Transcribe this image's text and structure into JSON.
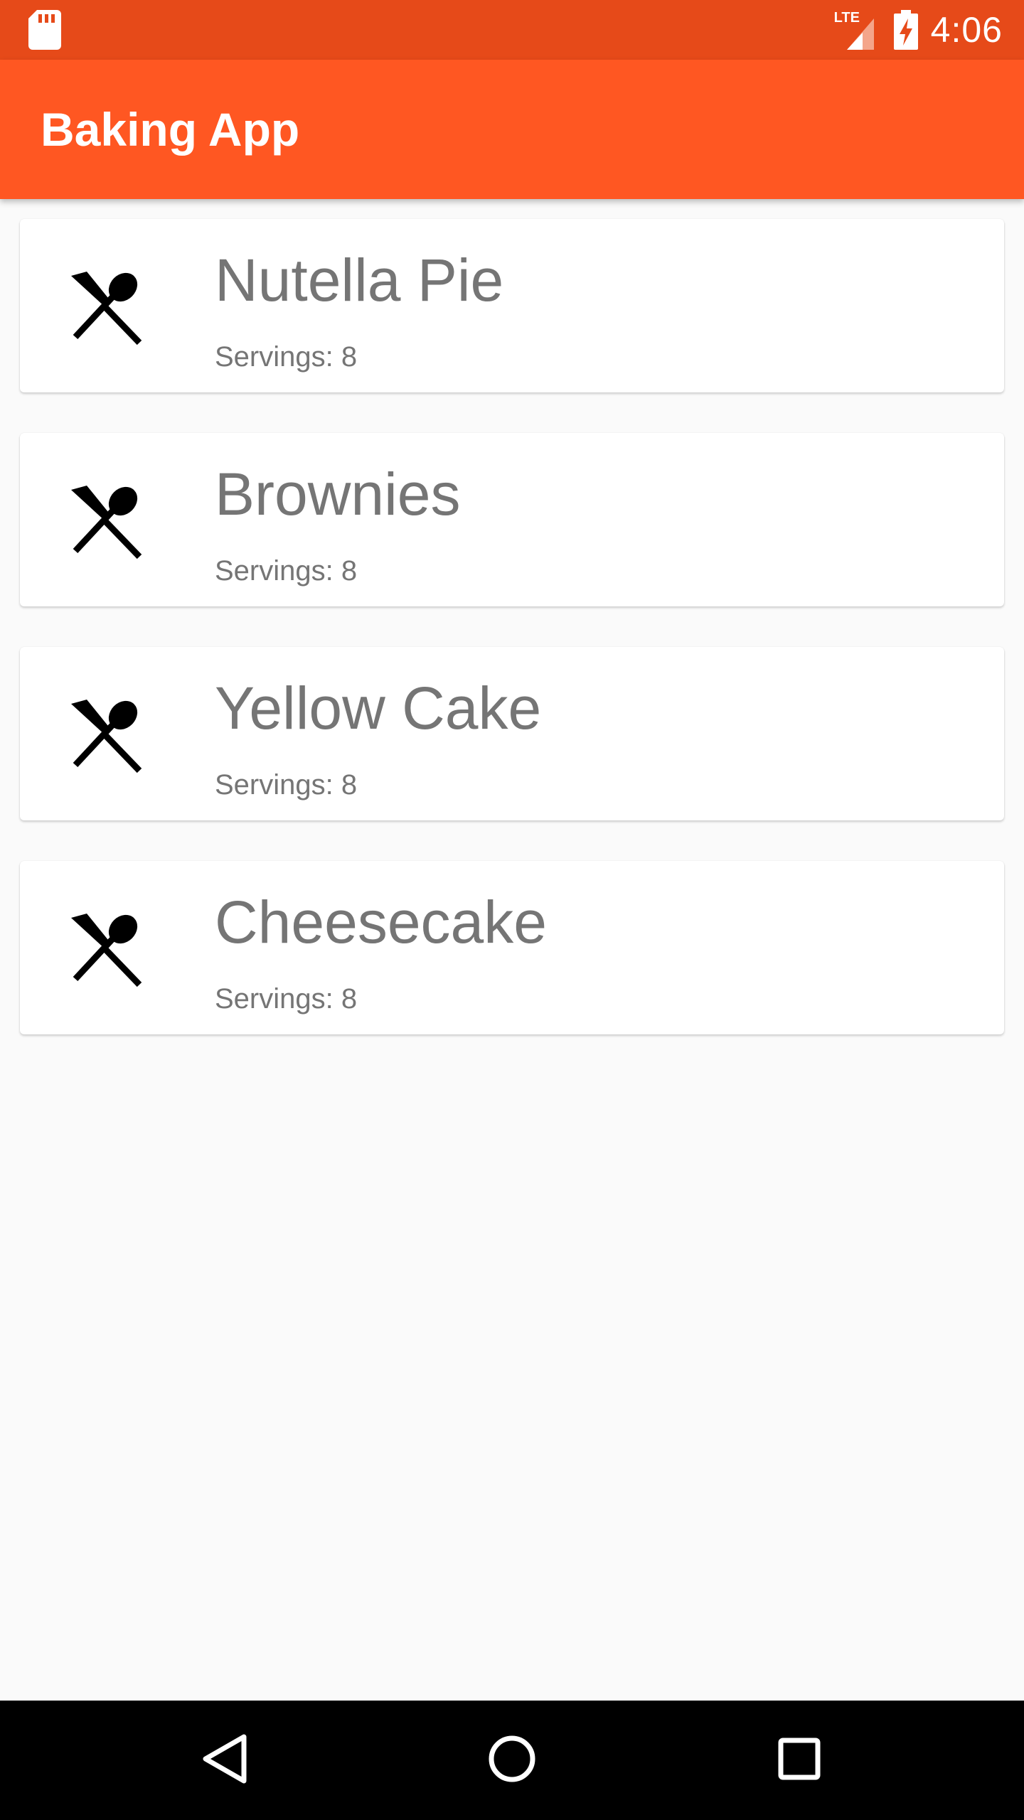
{
  "status_bar": {
    "time": "4:06",
    "network": "LTE",
    "icons": [
      "sd-card-icon",
      "signal-icon",
      "battery-charging-icon"
    ]
  },
  "app_bar": {
    "title": "Baking App"
  },
  "recipes": [
    {
      "name": "Nutella Pie",
      "servings": "Servings: 8",
      "icon": "utensils-icon"
    },
    {
      "name": "Brownies",
      "servings": "Servings: 8",
      "icon": "utensils-icon"
    },
    {
      "name": "Yellow Cake",
      "servings": "Servings: 8",
      "icon": "utensils-icon"
    },
    {
      "name": "Cheesecake",
      "servings": "Servings: 8",
      "icon": "utensils-icon"
    }
  ],
  "nav_bar": {
    "buttons": [
      "back-icon",
      "home-icon",
      "recents-icon"
    ]
  },
  "colors": {
    "status_bar": "#e64a19",
    "app_bar": "#ff5722",
    "background": "#fafafa",
    "text_secondary": "#757575"
  }
}
